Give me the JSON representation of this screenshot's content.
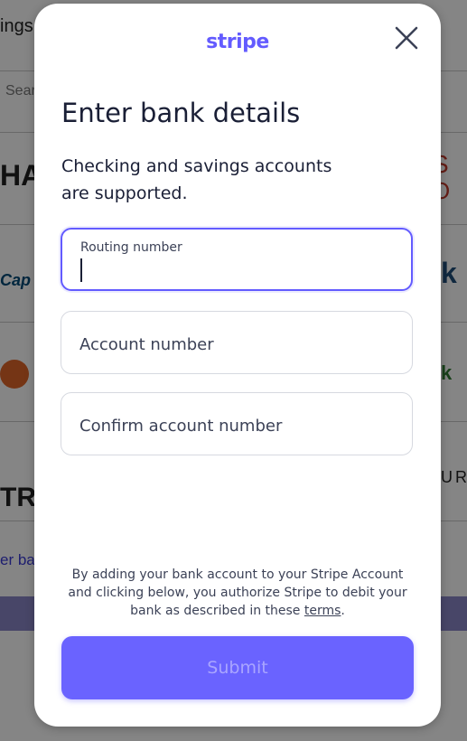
{
  "background": {
    "top_text": "ings",
    "search_text": "Sear",
    "bank_left_1": "HA",
    "bank_left_2": "Cap",
    "bank_left_3": "TR",
    "link_text": "er ban",
    "bank_right_1": "S",
    "bank_right_2": "O",
    "bank_right_3": "k",
    "bank_right_4": "k",
    "bank_right_5": "URY"
  },
  "modal": {
    "logo_text": "stripe",
    "title": "Enter bank details",
    "subtitle": "Checking and savings accounts are supported.",
    "fields": [
      {
        "label": "Routing number",
        "value": "",
        "focused": true
      },
      {
        "label": "Account number",
        "value": ""
      },
      {
        "label": "Confirm account number",
        "value": ""
      }
    ],
    "legal_before": "By adding your bank account to your Stripe Account and clicking below, you authorize Stripe to debit your bank as described in these ",
    "legal_link": "terms",
    "legal_after": ".",
    "submit_label": "Submit"
  },
  "colors": {
    "accent": "#635bff",
    "submit_bg": "#6a63ff",
    "submit_text": "#a9a5ff",
    "text": "#1a1f36"
  }
}
